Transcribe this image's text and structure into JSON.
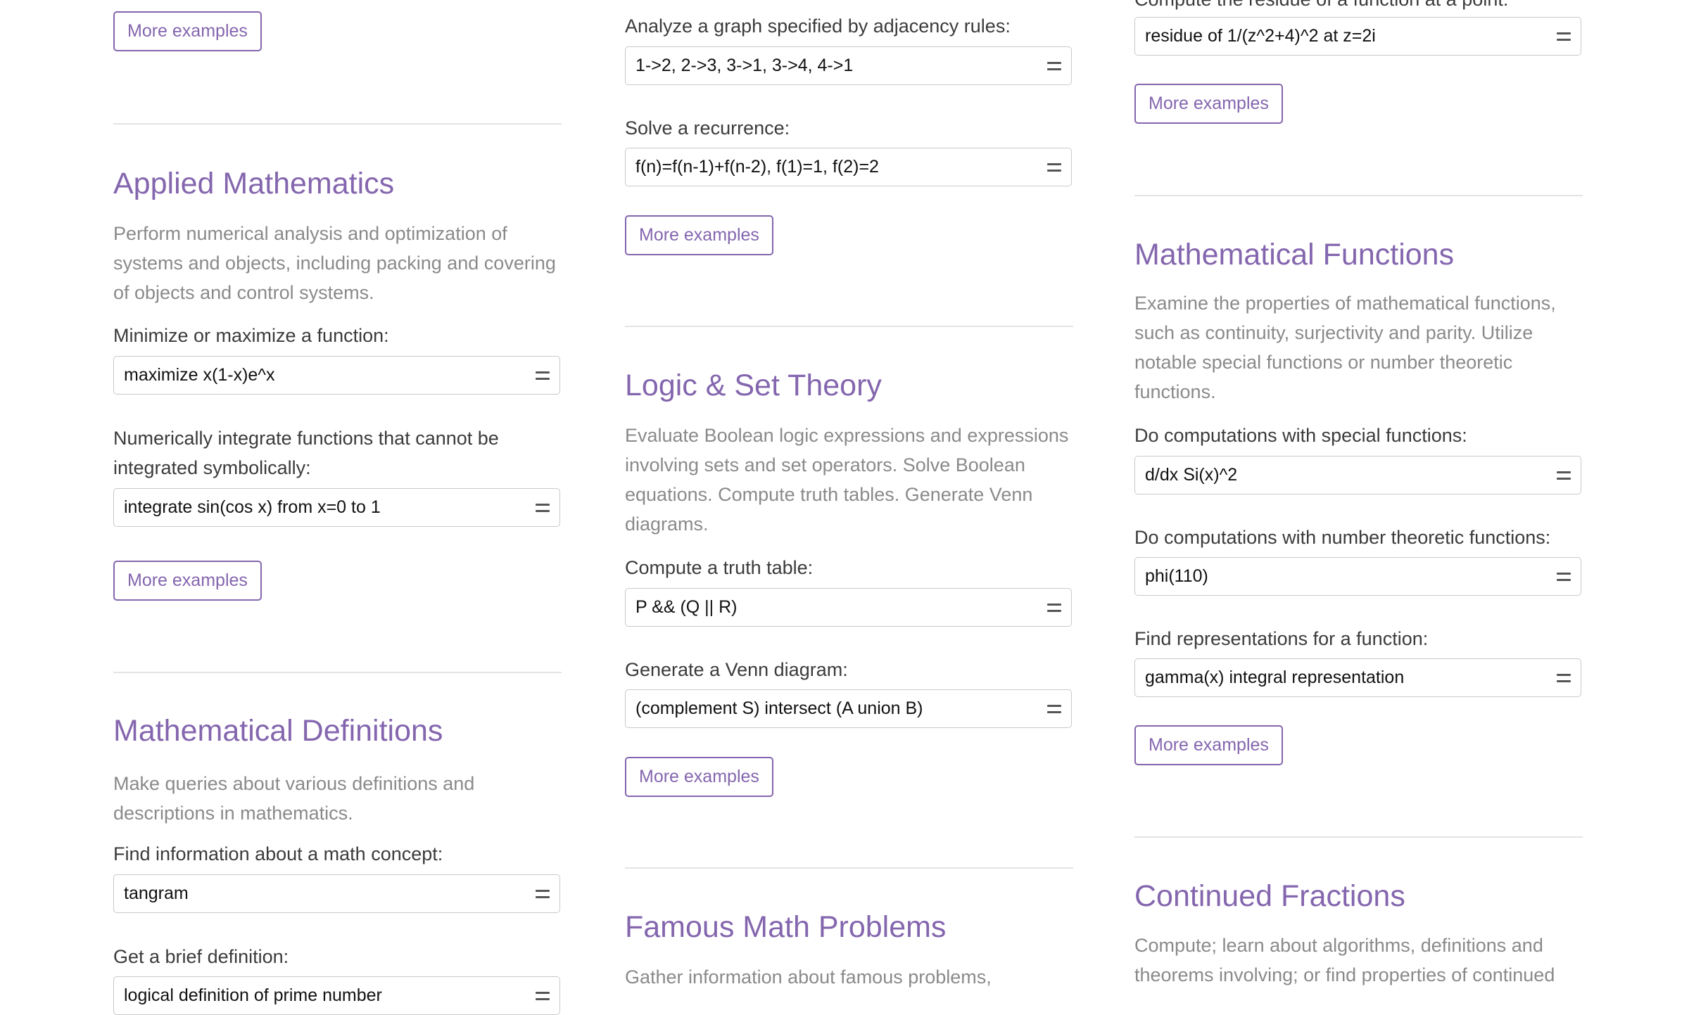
{
  "col1": {
    "top_more": "More examples",
    "applied": {
      "title": "Applied Mathematics",
      "desc": "Perform numerical analysis and optimization of systems and objects, including packing and covering of objects and control systems.",
      "ex1_label": "Minimize or maximize a function:",
      "ex1_value": "maximize x(1-x)e^x",
      "ex2_label": "Numerically integrate functions that cannot be integrated symbolically:",
      "ex2_value": "integrate sin(cos x) from x=0 to 1",
      "more": "More examples"
    },
    "definitions": {
      "title": "Mathematical Definitions",
      "desc": "Make queries about various definitions and descriptions in mathematics.",
      "ex1_label": "Find information about a math concept:",
      "ex1_value": "tangram",
      "ex2_label": "Get a brief definition:",
      "ex2_value": "logical definition of prime number"
    }
  },
  "col2": {
    "ex1_label": "Analyze a graph specified by adjacency rules:",
    "ex1_value": "1->2, 2->3, 3->1, 3->4, 4->1",
    "ex2_label": "Solve a recurrence:",
    "ex2_value": "f(n)=f(n-1)+f(n-2), f(1)=1, f(2)=2",
    "more": "More examples",
    "logic": {
      "title": "Logic & Set Theory",
      "desc": "Evaluate Boolean logic expressions and expressions involving sets and set operators. Solve Boolean equations. Compute truth tables. Generate Venn diagrams.",
      "ex1_label": "Compute a truth table:",
      "ex1_value": "P && (Q || R)",
      "ex2_label": "Generate a Venn diagram:",
      "ex2_value": "(complement S) intersect (A union B)",
      "more": "More examples"
    },
    "famous": {
      "title": "Famous Math Problems",
      "desc": "Gather information about famous problems,"
    }
  },
  "col3": {
    "top_label": "Compute the residue of a function at a point:",
    "top_value": "residue of 1/(z^2+4)^2 at z=2i",
    "top_more": "More examples",
    "functions": {
      "title": "Mathematical Functions",
      "desc": "Examine the properties of mathematical functions, such as continuity, surjectivity and parity. Utilize notable special functions or number theoretic functions.",
      "ex1_label": "Do computations with special functions:",
      "ex1_value": "d/dx Si(x)^2",
      "ex2_label": "Do computations with number theoretic functions:",
      "ex2_value": "phi(110)",
      "ex3_label": "Find representations for a function:",
      "ex3_value": "gamma(x) integral representation",
      "more": "More examples"
    },
    "continued": {
      "title": "Continued Fractions",
      "desc": "Compute; learn about algorithms, definitions and theorems involving; or find properties of continued"
    }
  },
  "colors": {
    "accent": "#8466ae",
    "divider": "#e4e4e4",
    "desc": "#8a8a8a"
  },
  "icons": {
    "compute": "equals-icon"
  }
}
